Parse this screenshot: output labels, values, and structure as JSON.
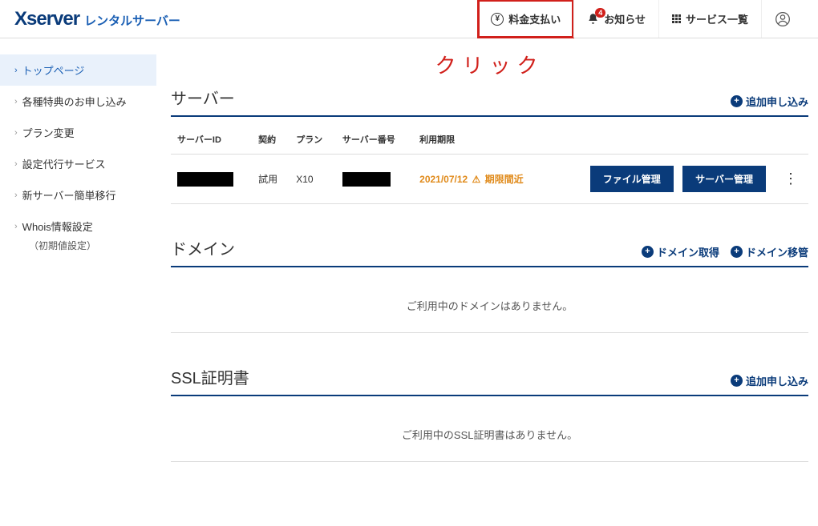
{
  "header": {
    "logo_main": "Xserver",
    "logo_sub": "レンタルサーバー",
    "nav": {
      "payment": "料金支払い",
      "notice": "お知らせ",
      "notice_badge": "4",
      "services": "サービス一覧"
    }
  },
  "annotation": "クリック",
  "sidebar": {
    "items": [
      "トップページ",
      "各種特典のお申し込み",
      "プラン変更",
      "設定代行サービス",
      "新サーバー簡単移行",
      "Whois情報設定"
    ],
    "whois_sub": "（初期値設定）"
  },
  "sections": {
    "server": {
      "title": "サーバー",
      "action_add": "追加申し込み",
      "cols": {
        "id": "サーバーID",
        "contract": "契約",
        "plan": "プラン",
        "number": "サーバー番号",
        "expiry": "利用期限"
      },
      "rows": [
        {
          "contract": "試用",
          "plan": "X10",
          "expiry_date": "2021/07/12",
          "expiry_warn": "期限間近"
        }
      ],
      "btn_file": "ファイル管理",
      "btn_manage": "サーバー管理"
    },
    "domain": {
      "title": "ドメイン",
      "action_get": "ドメイン取得",
      "action_transfer": "ドメイン移管",
      "empty": "ご利用中のドメインはありません。"
    },
    "ssl": {
      "title": "SSL証明書",
      "action_add": "追加申し込み",
      "empty": "ご利用中のSSL証明書はありません。"
    }
  }
}
